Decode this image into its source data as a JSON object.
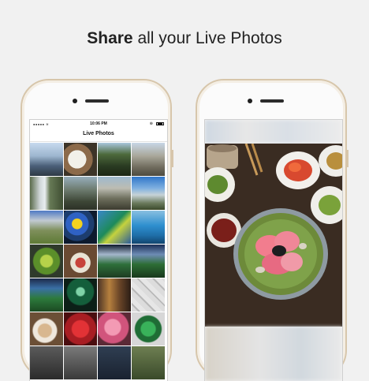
{
  "headline": {
    "bold": "Share",
    "rest": " all your Live Photos"
  },
  "left_phone": {
    "status": {
      "signal": "●●●●● ≋",
      "time": "10:06 PM",
      "lock": "⊛"
    },
    "nav_title": "Live Photos",
    "tiles": [
      {
        "kind": "t-city",
        "name": "photo-thumbnail-city"
      },
      {
        "kind": "t-food",
        "name": "photo-thumbnail-food"
      },
      {
        "kind": "t-forest",
        "name": "photo-thumbnail-forest"
      },
      {
        "kind": "t-rocks",
        "name": "photo-thumbnail-rocks"
      },
      {
        "kind": "t-fall",
        "name": "photo-thumbnail-waterfall"
      },
      {
        "kind": "t-valley",
        "name": "photo-thumbnail-valley"
      },
      {
        "kind": "t-halfdome",
        "name": "photo-thumbnail-granite"
      },
      {
        "kind": "t-lake",
        "name": "photo-thumbnail-sky"
      },
      {
        "kind": "t-meadow",
        "name": "photo-thumbnail-meadow"
      },
      {
        "kind": "t-floral",
        "name": "photo-thumbnail-flowers"
      },
      {
        "kind": "t-aqua",
        "name": "photo-thumbnail-aquarium"
      },
      {
        "kind": "t-pool",
        "name": "photo-thumbnail-pool"
      },
      {
        "kind": "t-plant",
        "name": "photo-thumbnail-plant"
      },
      {
        "kind": "t-dish",
        "name": "photo-thumbnail-dish"
      },
      {
        "kind": "t-stadium",
        "name": "photo-thumbnail-stadium"
      },
      {
        "kind": "t-field",
        "name": "photo-thumbnail-field"
      },
      {
        "kind": "t-ballpark",
        "name": "photo-thumbnail-ballpark"
      },
      {
        "kind": "t-night",
        "name": "photo-thumbnail-night-field"
      },
      {
        "kind": "t-museum",
        "name": "photo-thumbnail-museum"
      },
      {
        "kind": "t-climb",
        "name": "photo-thumbnail-climbing-wall"
      },
      {
        "kind": "t-platter",
        "name": "photo-thumbnail-platter"
      },
      {
        "kind": "t-red",
        "name": "photo-thumbnail-red"
      },
      {
        "kind": "t-blossom",
        "name": "photo-thumbnail-blossom"
      },
      {
        "kind": "t-monster",
        "name": "photo-thumbnail-green-monster"
      },
      {
        "kind": "t-dark1",
        "name": "photo-thumbnail"
      },
      {
        "kind": "t-dark2",
        "name": "photo-thumbnail"
      },
      {
        "kind": "t-dark3",
        "name": "photo-thumbnail"
      },
      {
        "kind": "t-dark4",
        "name": "photo-thumbnail"
      }
    ]
  },
  "colors": {
    "background": "#f1f1f1",
    "phone_frame": "#d7c6ab"
  }
}
